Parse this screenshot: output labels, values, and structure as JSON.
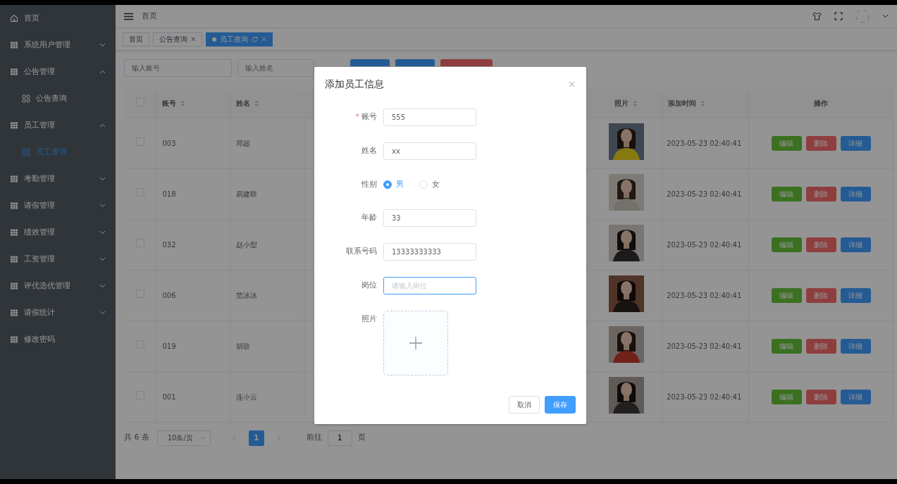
{
  "sidebar": {
    "items": [
      {
        "kind": "home",
        "label": "首页",
        "selected": false
      },
      {
        "kind": "group",
        "label": "系统用户管理",
        "expanded": false
      },
      {
        "kind": "group",
        "label": "公告管理",
        "expanded": true,
        "children": [
          {
            "label": "公告查询",
            "selected": false
          }
        ]
      },
      {
        "kind": "group",
        "label": "员工管理",
        "expanded": true,
        "children": [
          {
            "label": "员工查询",
            "selected": true
          }
        ]
      },
      {
        "kind": "group",
        "label": "考勤管理",
        "expanded": false
      },
      {
        "kind": "group",
        "label": "请假管理",
        "expanded": false
      },
      {
        "kind": "group",
        "label": "绩效管理",
        "expanded": false
      },
      {
        "kind": "group",
        "label": "工资管理",
        "expanded": false
      },
      {
        "kind": "group",
        "label": "评优选优管理",
        "expanded": false
      },
      {
        "kind": "group",
        "label": "请假统计",
        "expanded": false
      },
      {
        "kind": "link",
        "label": "修改密码",
        "selected": false
      }
    ]
  },
  "header": {
    "breadcrumb": "首页"
  },
  "tabs": [
    {
      "label": "首页",
      "selected": false,
      "closable": false
    },
    {
      "label": "公告查询",
      "selected": false,
      "closable": true
    },
    {
      "label": "员工查询",
      "selected": true,
      "closable": true
    }
  ],
  "filters": [
    {
      "placeholder": "输入账号"
    },
    {
      "placeholder": "输入姓名"
    }
  ],
  "toolbar_buttons": [
    {
      "kind": "primary"
    },
    {
      "kind": "primary"
    },
    {
      "kind": "danger"
    }
  ],
  "table": {
    "all_selected": false,
    "columns_left": [
      {
        "label": "账号",
        "sortable": true
      },
      {
        "label": "姓名",
        "sortable": true
      }
    ],
    "columns_right": [
      {
        "label": "照片",
        "sortable": true
      },
      {
        "label": "添加时间",
        "sortable": true
      },
      {
        "label": "操作",
        "sortable": false
      }
    ],
    "rows": [
      {
        "selected": false,
        "account": "003",
        "name": "邓超",
        "added": "2023-05-23 02:40:41",
        "actions": [
          "编辑",
          "删除",
          "详细"
        ]
      },
      {
        "selected": false,
        "account": "018",
        "name": "易建联",
        "added": "2023-05-23 02:40:41",
        "actions": [
          "编辑",
          "删除",
          "详细"
        ]
      },
      {
        "selected": false,
        "account": "032",
        "name": "赵小型",
        "added": "2023-05-23 02:40:41",
        "actions": [
          "编辑",
          "删除",
          "详细"
        ]
      },
      {
        "selected": false,
        "account": "006",
        "name": "范冰冰",
        "added": "2023-05-23 02:40:41",
        "actions": [
          "编辑",
          "删除",
          "详细"
        ]
      },
      {
        "selected": false,
        "account": "019",
        "name": "胡歌",
        "added": "2023-05-23 02:40:41",
        "actions": [
          "编辑",
          "删除",
          "详细"
        ]
      },
      {
        "selected": false,
        "account": "001",
        "name": "连小云",
        "added": "2023-05-23 02:40:41",
        "actions": [
          "编辑",
          "删除",
          "详细"
        ]
      }
    ]
  },
  "pagination": {
    "total": "共 6 条",
    "page_size": "10条/页",
    "pages": [
      {
        "label": "1",
        "selected": true
      }
    ],
    "goto_label": "前往",
    "goto_value": "1",
    "goto_suffix": "页"
  },
  "modal": {
    "title": "添加员工信息",
    "fields": [
      {
        "kind": "text",
        "required_mark": "*",
        "label": "账号",
        "value": "555",
        "focused": false
      },
      {
        "kind": "text",
        "label": "姓名",
        "value": "xx",
        "focused": false
      },
      {
        "kind": "radio",
        "label": "性别",
        "options": [
          {
            "label": "男",
            "selected": true
          },
          {
            "label": "女",
            "selected": false
          }
        ]
      },
      {
        "kind": "text",
        "label": "年龄",
        "value": "33",
        "focused": false
      },
      {
        "kind": "text",
        "label": "联系号码",
        "value": "13333333333",
        "focused": false
      },
      {
        "kind": "text",
        "label": "岗位",
        "placeholder": "请输入岗位",
        "focused": true
      },
      {
        "kind": "upload",
        "label": "照片"
      }
    ],
    "buttons": [
      {
        "label": "取消",
        "kind": "secondary"
      },
      {
        "label": "保存",
        "kind": "primary"
      }
    ]
  }
}
